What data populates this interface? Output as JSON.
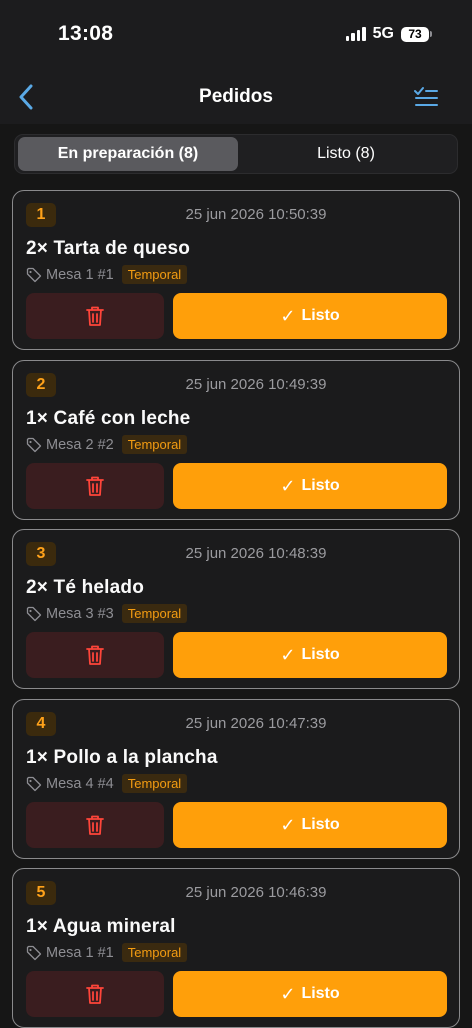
{
  "status": {
    "time": "13:08",
    "network": "5G",
    "battery": "73"
  },
  "nav": {
    "title": "Pedidos",
    "back_icon": "chevron-left-icon",
    "list_icon": "checklist-icon"
  },
  "tabs": [
    {
      "label": "En preparación (8)",
      "active": true
    },
    {
      "label": "Listo (8)",
      "active": false
    }
  ],
  "orders": [
    {
      "number": "1",
      "timestamp": "25 jun 2026 10:50:39",
      "item": "2× Tarta de queso",
      "table": "Mesa 1 #1",
      "tag": "Temporal",
      "ready_label": "Listo"
    },
    {
      "number": "2",
      "timestamp": "25 jun 2026 10:49:39",
      "item": "1× Café con leche",
      "table": "Mesa 2 #2",
      "tag": "Temporal",
      "ready_label": "Listo"
    },
    {
      "number": "3",
      "timestamp": "25 jun 2026 10:48:39",
      "item": "2× Té helado",
      "table": "Mesa 3 #3",
      "tag": "Temporal",
      "ready_label": "Listo"
    },
    {
      "number": "4",
      "timestamp": "25 jun 2026 10:47:39",
      "item": "1× Pollo a la plancha",
      "table": "Mesa 4 #4",
      "tag": "Temporal",
      "ready_label": "Listo"
    },
    {
      "number": "5",
      "timestamp": "25 jun 2026 10:46:39",
      "item": "1× Agua mineral",
      "table": "Mesa 1 #1",
      "tag": "Temporal",
      "ready_label": "Listo"
    }
  ],
  "colors": {
    "accent": "#ff9f0a",
    "danger": "#ff453a",
    "link": "#5aa9e6"
  }
}
